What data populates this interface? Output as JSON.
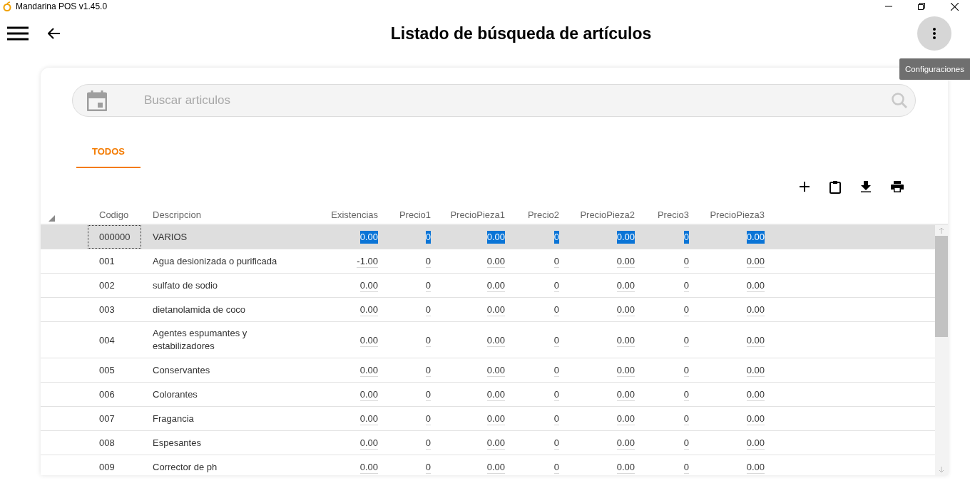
{
  "window": {
    "title": "Mandarina POS v1.45.0"
  },
  "header": {
    "title": "Listado de búsqueda de artículos",
    "tooltip": "Configuraciones"
  },
  "search": {
    "placeholder": "Buscar articulos"
  },
  "tabs": [
    {
      "label": "TODOS",
      "selected": true
    }
  ],
  "table": {
    "columns": [
      "Codigo",
      "Descripcion",
      "Existencias",
      "Precio1",
      "PrecioPieza1",
      "Precio2",
      "PrecioPieza2",
      "Precio3",
      "PrecioPieza3"
    ],
    "rows": [
      {
        "code": "000000",
        "description": "VARIOS",
        "values": [
          "0.00",
          "0",
          "0.00",
          "0",
          "0.00",
          "0",
          "0.00"
        ],
        "selected": true
      },
      {
        "code": "001",
        "description": "Agua desionizada o purificada",
        "values": [
          "-1.00",
          "0",
          "0.00",
          "0",
          "0.00",
          "0",
          "0.00"
        ],
        "selected": false
      },
      {
        "code": "002",
        "description": "sulfato de sodio",
        "values": [
          "0.00",
          "0",
          "0.00",
          "0",
          "0.00",
          "0",
          "0.00"
        ],
        "selected": false
      },
      {
        "code": "003",
        "description": "dietanolamida de coco",
        "values": [
          "0.00",
          "0",
          "0.00",
          "0",
          "0.00",
          "0",
          "0.00"
        ],
        "selected": false
      },
      {
        "code": "004",
        "description": "Agentes espumantes y estabilizadores",
        "values": [
          "0.00",
          "0",
          "0.00",
          "0",
          "0.00",
          "0",
          "0.00"
        ],
        "selected": false
      },
      {
        "code": "005",
        "description": "Conservantes",
        "values": [
          "0.00",
          "0",
          "0.00",
          "0",
          "0.00",
          "0",
          "0.00"
        ],
        "selected": false
      },
      {
        "code": "006",
        "description": "Colorantes",
        "values": [
          "0.00",
          "0",
          "0.00",
          "0",
          "0.00",
          "0",
          "0.00"
        ],
        "selected": false
      },
      {
        "code": "007",
        "description": "Fragancia",
        "values": [
          "0.00",
          "0",
          "0.00",
          "0",
          "0.00",
          "0",
          "0.00"
        ],
        "selected": false
      },
      {
        "code": "008",
        "description": "Espesantes",
        "values": [
          "0.00",
          "0",
          "0.00",
          "0",
          "0.00",
          "0",
          "0.00"
        ],
        "selected": false
      },
      {
        "code": "009",
        "description": "Corrector de ph",
        "values": [
          "0.00",
          "0",
          "0.00",
          "0",
          "0.00",
          "0",
          "0.00"
        ],
        "selected": false
      }
    ]
  }
}
